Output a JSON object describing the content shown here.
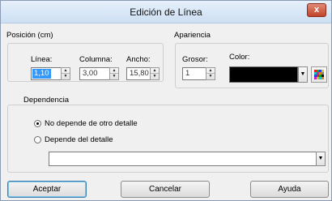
{
  "window": {
    "title": "Edición de Línea",
    "close_glyph": "x"
  },
  "posicion": {
    "group_label": "Posición (cm)",
    "linea_label": "Línea:",
    "linea_value": "1,10",
    "columna_label": "Columna:",
    "columna_value": "3,00",
    "ancho_label": "Ancho:",
    "ancho_value": "15,80"
  },
  "apariencia": {
    "group_label": "Apariencia",
    "grosor_label": "Grosor:",
    "grosor_value": "1",
    "color_label": "Color:",
    "color_value": "#000000",
    "palette_icon": "color-palette-icon"
  },
  "dependencia": {
    "group_label": "Dependencia",
    "option_no": "No depende de otro detalle",
    "option_si": "Depende del detalle",
    "selected": "option_no",
    "detalle_value": ""
  },
  "buttons": {
    "accept": "Aceptar",
    "cancel": "Cancelar",
    "help": "Ayuda"
  },
  "colors": {
    "selection": "#3399ff",
    "dialog_bg": "#f0f0f0",
    "title_bg": "#cddff3"
  }
}
